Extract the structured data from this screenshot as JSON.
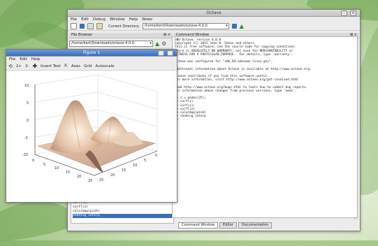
{
  "octave": {
    "title": "Octave",
    "menu": [
      "File",
      "Edit",
      "Debug",
      "Window",
      "Help",
      "News"
    ],
    "current_dir_label": "Current Directory:",
    "current_dir_value": "/home/bert/Downloads/octave-4.0.0",
    "file_browser_title": "File Browser",
    "file_browser_path": "/home/bert/Downloads/octave-4.0.0",
    "command_window_title": "Command Window",
    "console_lines": [
      "GNU Octave, version 4.0.0",
      "Copyright (C) 2015 John W. Eaton and others.",
      "This is free software; see the source code for copying conditions.",
      "There is ABSOLUTELY NO WARRANTY; not even for MERCHANTABILITY or",
      "FITNESS FOR A PARTICULAR PURPOSE.  For details, type 'warranty'.",
      "",
      "Octave was configured for \"x86_64-unknown-linux-gnu\".",
      "",
      "Additional information about Octave is available at http://www.octave.org.",
      "",
      "Please contribute if you find this software useful.",
      "For more information, visit http://www.octave.org/get-involved.html",
      "",
      "Read http://www.octave.org/bugs.html to learn how to submit bug reports.",
      "For information about changes from previous versions, type 'news'.",
      "",
      ">> z = peaks(25);",
      ">> surf(z)",
      ">> surf(z);",
      ">> surfl(z)",
      ">> colormap(pink)",
      ">> shading interp",
      ">> "
    ],
    "history": [
      "surfl(z)",
      "surfl(z)",
      "colormap(pink)",
      "shading interp"
    ],
    "tabs": [
      "Command Window",
      "Editor",
      "Documentation"
    ]
  },
  "figure": {
    "title": "Figure 1",
    "menu": [
      "File",
      "Edit",
      "Help"
    ],
    "toolbar": [
      "2+",
      "2-",
      "Insert Text",
      "Axes",
      "Grid",
      "Autoscale"
    ],
    "z_ticks": [
      "10",
      "5",
      "0",
      "-5",
      "-10"
    ],
    "x_ticks": [
      "0",
      "5",
      "10",
      "15",
      "20",
      "25"
    ],
    "y_ticks": [
      "25",
      "20",
      "15",
      "10",
      "5",
      "0"
    ]
  },
  "colors": {
    "title_active": "#3d6db8",
    "surface_light": "#f6e4cf",
    "surface_dark": "#9c7060",
    "console_bg": "#ffffff"
  }
}
